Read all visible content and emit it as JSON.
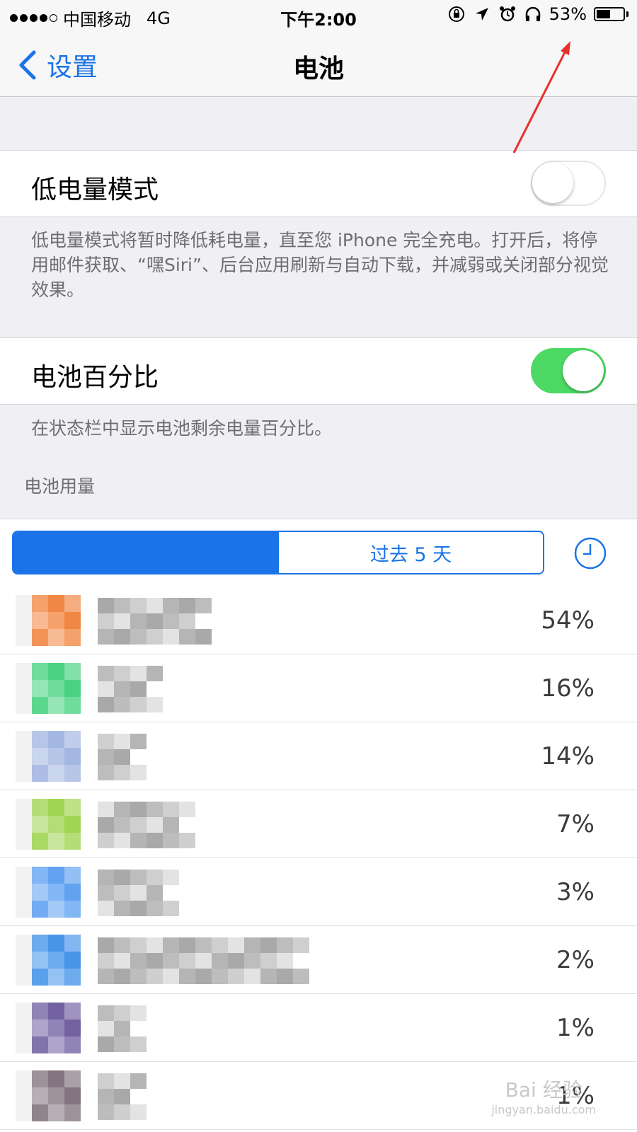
{
  "status_bar": {
    "carrier": "中国移动",
    "network": "4G",
    "time": "下午2:00",
    "battery_percent_text": "53%",
    "battery_level": 0.53,
    "icons": [
      "orientation-lock-icon",
      "location-icon",
      "alarm-icon",
      "headphones-icon",
      "battery-icon"
    ]
  },
  "nav": {
    "back_label": "设置",
    "title": "电池"
  },
  "low_power": {
    "label": "低电量模式",
    "enabled": false,
    "footer": "低电量模式将暂时降低耗电量，直至您 iPhone 完全充电。打开后，将停用邮件获取、“嘿Siri”、后台应用刷新与自动下载，并减弱或关闭部分视觉效果。"
  },
  "battery_percentage": {
    "label": "电池百分比",
    "enabled": true,
    "footer": "在状态栏中显示电池剩余电量百分比。"
  },
  "usage": {
    "section_header": "电池用量",
    "segments": [
      "",
      "过去 5 天"
    ],
    "apps": [
      {
        "percent": "54%",
        "color": "#f0813a"
      },
      {
        "percent": "16%",
        "color": "#3fd07a"
      },
      {
        "percent": "14%",
        "color": "#9fb2e0"
      },
      {
        "percent": "7%",
        "color": "#9cd24a"
      },
      {
        "percent": "3%",
        "color": "#5a9df0"
      },
      {
        "percent": "2%",
        "color": "#3d8fe8"
      },
      {
        "percent": "1%",
        "color": "#6b5a9c"
      },
      {
        "percent": "1%",
        "color": "#7d6d78"
      }
    ]
  },
  "colors": {
    "accent": "#1a73e8",
    "toggle_on": "#4cd964",
    "annotation_arrow": "#e8302a"
  },
  "watermark": {
    "main": "Bai 经验",
    "sub": "jingyan.baidu.com"
  }
}
